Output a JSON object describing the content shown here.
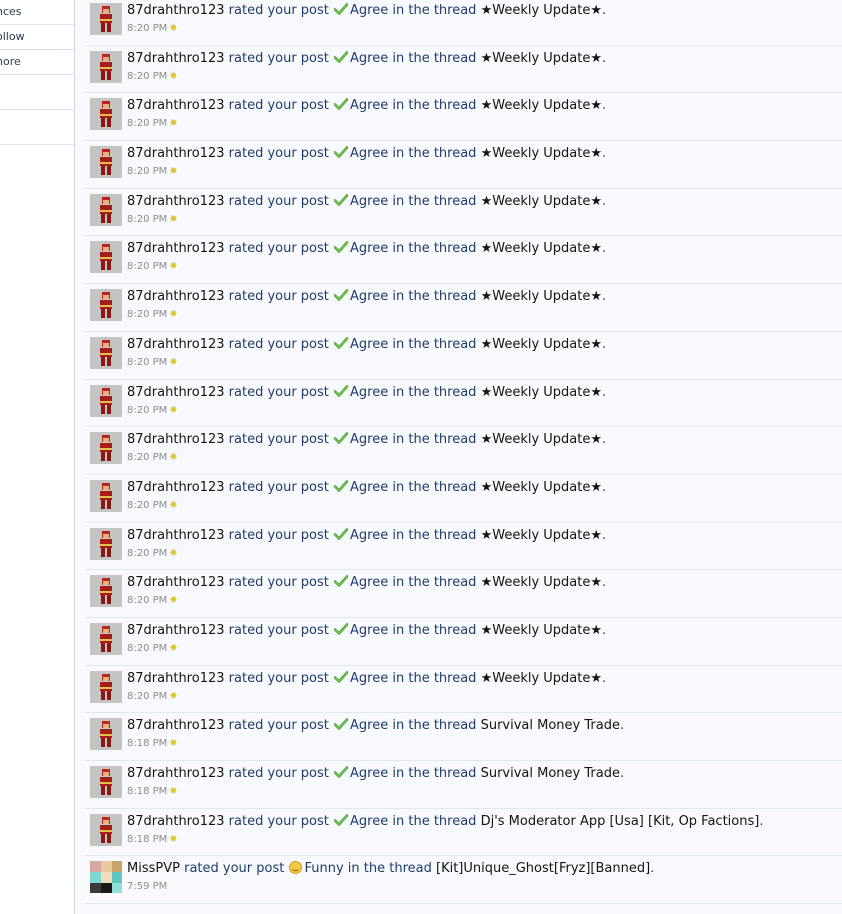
{
  "sidebar": {
    "items": [
      "nces",
      "ollow",
      "nore"
    ]
  },
  "alerts": [
    {
      "user": "87drahthro123",
      "action": "rated your post",
      "rating": "Agree",
      "connector": "in the thread",
      "thread": "★Weekly Update★",
      "end": ".",
      "time": "8:20 PM"
    },
    {
      "user": "87drahthro123",
      "action": "rated your post",
      "rating": "Agree",
      "connector": "in the thread",
      "thread": "★Weekly Update★",
      "end": ".",
      "time": "8:20 PM"
    },
    {
      "user": "87drahthro123",
      "action": "rated your post",
      "rating": "Agree",
      "connector": "in the thread",
      "thread": "★Weekly Update★",
      "end": ".",
      "time": "8:20 PM"
    },
    {
      "user": "87drahthro123",
      "action": "rated your post",
      "rating": "Agree",
      "connector": "in the thread",
      "thread": "★Weekly Update★",
      "end": ".",
      "time": "8:20 PM"
    },
    {
      "user": "87drahthro123",
      "action": "rated your post",
      "rating": "Agree",
      "connector": "in the thread",
      "thread": "★Weekly Update★",
      "end": ".",
      "time": "8:20 PM"
    },
    {
      "user": "87drahthro123",
      "action": "rated your post",
      "rating": "Agree",
      "connector": "in the thread",
      "thread": "★Weekly Update★",
      "end": ".",
      "time": "8:20 PM"
    },
    {
      "user": "87drahthro123",
      "action": "rated your post",
      "rating": "Agree",
      "connector": "in the thread",
      "thread": "★Weekly Update★",
      "end": ".",
      "time": "8:20 PM"
    },
    {
      "user": "87drahthro123",
      "action": "rated your post",
      "rating": "Agree",
      "connector": "in the thread",
      "thread": "★Weekly Update★",
      "end": ".",
      "time": "8:20 PM"
    },
    {
      "user": "87drahthro123",
      "action": "rated your post",
      "rating": "Agree",
      "connector": "in the thread",
      "thread": "★Weekly Update★",
      "end": ".",
      "time": "8:20 PM"
    },
    {
      "user": "87drahthro123",
      "action": "rated your post",
      "rating": "Agree",
      "connector": "in the thread",
      "thread": "★Weekly Update★",
      "end": ".",
      "time": "8:20 PM"
    },
    {
      "user": "87drahthro123",
      "action": "rated your post",
      "rating": "Agree",
      "connector": "in the thread",
      "thread": "★Weekly Update★",
      "end": ".",
      "time": "8:20 PM"
    },
    {
      "user": "87drahthro123",
      "action": "rated your post",
      "rating": "Agree",
      "connector": "in the thread",
      "thread": "★Weekly Update★",
      "end": ".",
      "time": "8:20 PM"
    },
    {
      "user": "87drahthro123",
      "action": "rated your post",
      "rating": "Agree",
      "connector": "in the thread",
      "thread": "★Weekly Update★",
      "end": ".",
      "time": "8:20 PM"
    },
    {
      "user": "87drahthro123",
      "action": "rated your post",
      "rating": "Agree",
      "connector": "in the thread",
      "thread": "★Weekly Update★",
      "end": ".",
      "time": "8:20 PM"
    },
    {
      "user": "87drahthro123",
      "action": "rated your post",
      "rating": "Agree",
      "connector": "in the thread",
      "thread": "★Weekly Update★",
      "end": ".",
      "time": "8:20 PM"
    },
    {
      "user": "87drahthro123",
      "action": "rated your post",
      "rating": "Agree",
      "connector": "in the thread",
      "thread": "Survival Money Trade",
      "end": ".",
      "time": "8:18 PM"
    },
    {
      "user": "87drahthro123",
      "action": "rated your post",
      "rating": "Agree",
      "connector": "in the thread",
      "thread": "Survival Money Trade",
      "end": ".",
      "time": "8:18 PM"
    },
    {
      "user": "87drahthro123",
      "action": "rated your post",
      "rating": "Agree",
      "connector": "in the thread",
      "thread": "Dj's Moderator App [Usa] [Kit, Op Factions]",
      "end": ".",
      "time": "8:18 PM"
    },
    {
      "user": "MissPVP",
      "action": "rated your post",
      "rating": "Funny",
      "connector": "in the thread",
      "thread": "[Kit]Unique_Ghost[Fryz][Banned]",
      "end": ".",
      "time": "7:59 PM"
    }
  ],
  "colors": {
    "link": "#203c6a",
    "username": "#141414",
    "time": "#8c8c8c",
    "divider": "#dfe7f1",
    "agree_check": "#3f9b2a",
    "new_star": "#e2c534"
  },
  "icons": {
    "agree": "check-icon",
    "funny": "smiley-icon",
    "new": "star-icon"
  }
}
